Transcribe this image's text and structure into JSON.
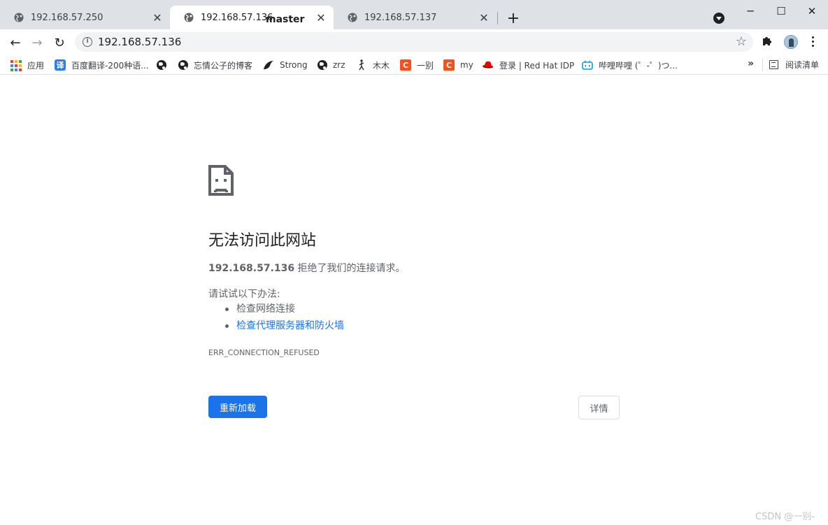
{
  "tabs": [
    {
      "title": "192.168.57.250",
      "active": false
    },
    {
      "title": "192.168.57.136",
      "active": true
    },
    {
      "title": "192.168.57.137",
      "active": false
    }
  ],
  "overlay_label": "master",
  "window_controls": {
    "minimize": "─",
    "maximize": "☐",
    "close": "✕"
  },
  "toolbar": {
    "back_icon": "←",
    "forward_icon": "→",
    "reload_icon": "↻",
    "url": "192.168.57.136"
  },
  "bookmarks": [
    {
      "label": "应用",
      "icon": "apps-icon"
    },
    {
      "label": "百度翻译-200种语...",
      "icon": "translate-icon",
      "glyph": "译",
      "color": "#2b7de9"
    },
    {
      "label": "",
      "icon": "globe-icon"
    },
    {
      "label": "忘情公子的博客",
      "icon": "globe-icon"
    },
    {
      "label": "Strong",
      "icon": "swirl-icon"
    },
    {
      "label": "zrz",
      "icon": "globe-icon"
    },
    {
      "label": "木木",
      "icon": "figure-icon"
    },
    {
      "label": "一别",
      "icon": "csdn-icon",
      "glyph": "C",
      "color": "#f4511e"
    },
    {
      "label": "my",
      "icon": "csdn-icon",
      "glyph": "C",
      "color": "#f4511e"
    },
    {
      "label": "登录 | Red Hat IDP",
      "icon": "redhat-icon"
    },
    {
      "label": "哔哩哔哩 (゜-゜)つ...",
      "icon": "bilibili-icon"
    }
  ],
  "bookmarks_overflow": "»",
  "reading_list": "阅读清单",
  "error": {
    "title": "无法访问此网站",
    "host": "192.168.57.136",
    "message": " 拒绝了我们的连接请求。",
    "try_label": "请试试以下办法:",
    "suggestions": [
      "检查网络连接",
      "检查代理服务器和防火墙"
    ],
    "code": "ERR_CONNECTION_REFUSED",
    "reload_label": "重新加载",
    "details_label": "详情"
  },
  "watermark": "CSDN @一别-"
}
